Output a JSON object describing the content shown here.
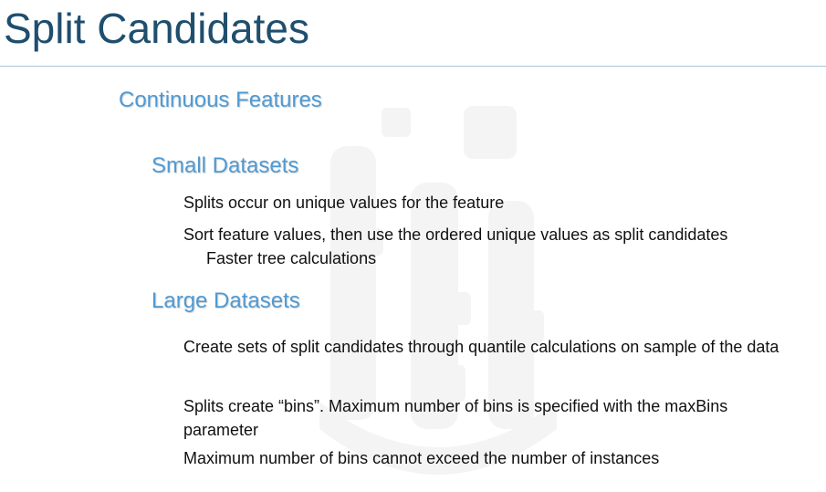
{
  "slide": {
    "title": "Split Candidates",
    "section_heading": "Continuous Features",
    "small_datasets": {
      "heading": "Small Datasets",
      "bullets": [
        "Splits occur on unique values for the feature",
        "Sort feature values, then use the ordered unique values as split candidates",
        "Faster tree calculations"
      ]
    },
    "large_datasets": {
      "heading": "Large Datasets",
      "bullets": [
        "Create sets of split candidates through quantile calculations on sample of the data",
        "Splits create “bins”.  Maximum number of bins is specified with the maxBins parameter",
        "Maximum number of bins cannot exceed the number of instances"
      ]
    },
    "colors": {
      "title": "#1f4e6e",
      "heading": "#4f9ad3",
      "body": "#111111",
      "rule": "#a9c6db",
      "watermark": "#f4f4f4"
    },
    "watermark_icon": "logo-watermark-icon"
  }
}
